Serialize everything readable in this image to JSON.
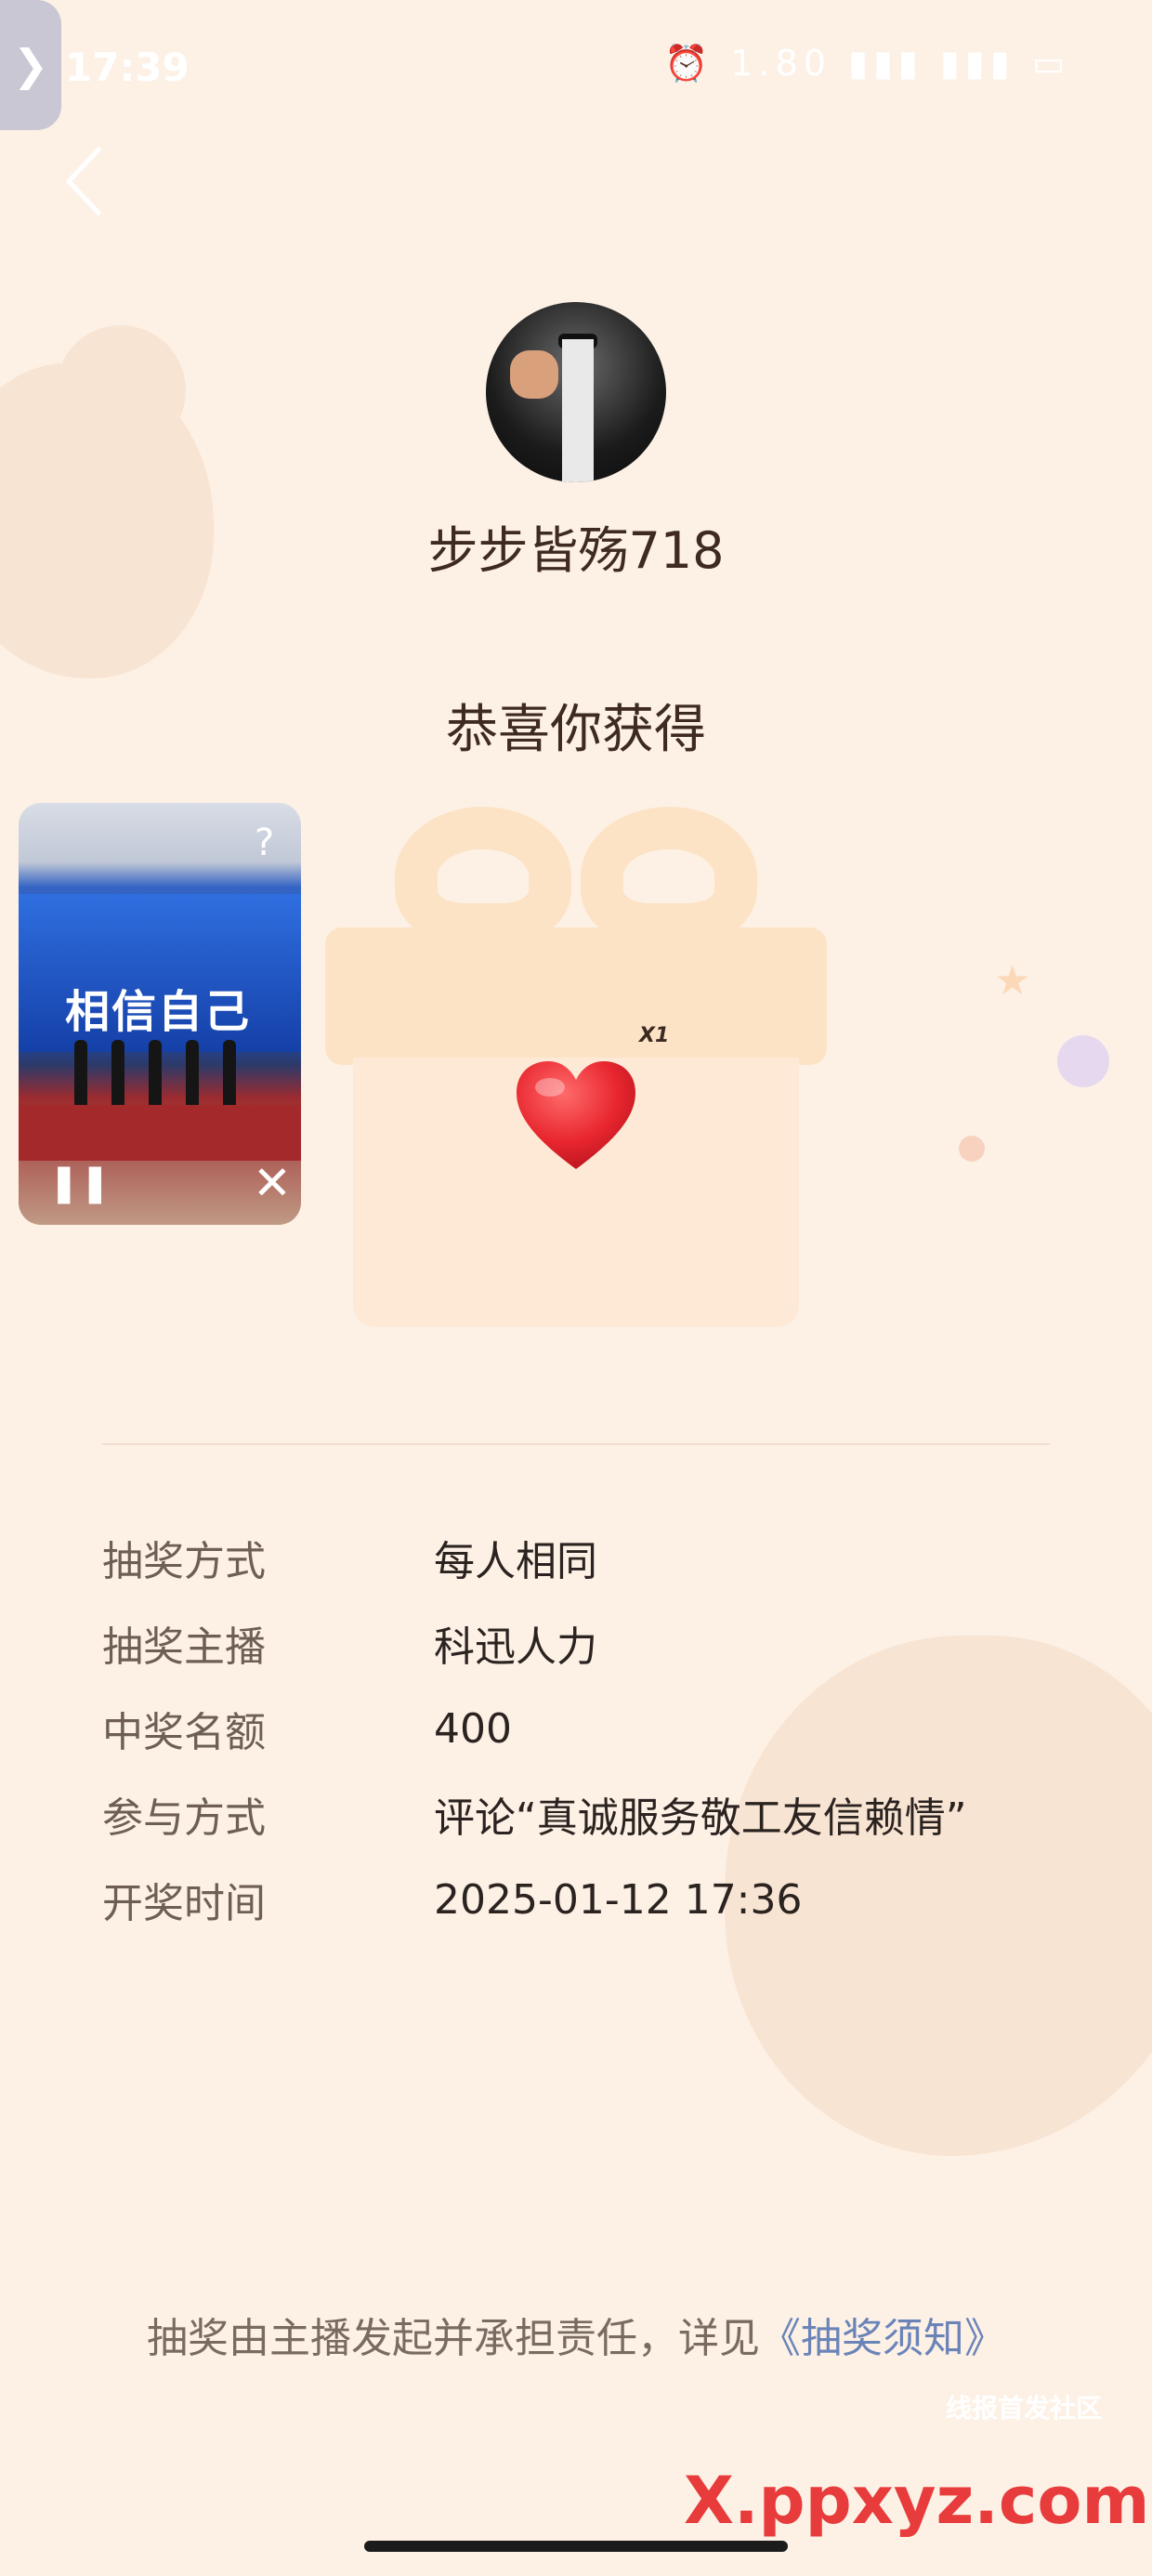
{
  "status_bar": {
    "time": "17:39",
    "icons_text": "⏰ 1.80 ▮▮▮ ▮▮▮ ▭"
  },
  "side_tab": {
    "glyph": "❯"
  },
  "profile": {
    "username": "步步皆殇718"
  },
  "prize": {
    "heading": "恭喜你获得",
    "quantity": "X1",
    "icon": "heart-icon"
  },
  "video": {
    "headline": "相信自己"
  },
  "details": [
    {
      "label": "抽奖方式",
      "value": "每人相同"
    },
    {
      "label": "抽奖主播",
      "value": "科迅人力"
    },
    {
      "label": "中奖名额",
      "value": "400"
    },
    {
      "label": "参与方式",
      "value": "评论“真诚服务敬工友信赖情”"
    },
    {
      "label": "开奖时间",
      "value": "2025-01-12 17:36"
    }
  ],
  "footer": {
    "text": "抽奖由主播发起并承担责任，详见",
    "link": "《抽奖须知》"
  },
  "watermark": {
    "top": "线报首发社区",
    "logo": "X.ppxyz.com"
  },
  "colors": {
    "background": "#fdf1e6",
    "heart": "#e8262f",
    "link": "#6b84b8"
  }
}
